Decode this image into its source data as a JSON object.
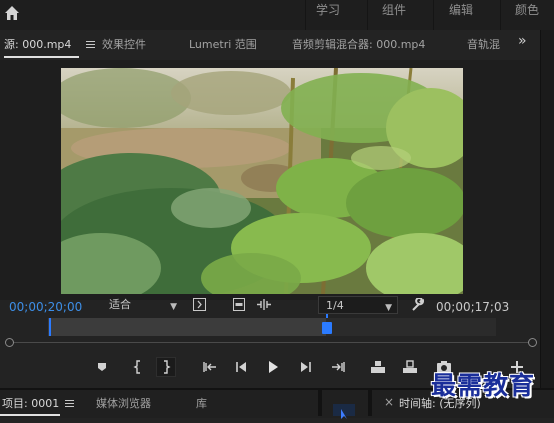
{
  "workspaces": [
    "学习",
    "组件",
    "编辑",
    "颜色"
  ],
  "tabs": [
    {
      "label": "源: 000.mp4",
      "active": true
    },
    {
      "label": "效果控件",
      "active": false
    },
    {
      "label": "Lumetri 范围",
      "active": false
    },
    {
      "label": "音频剪辑混合器: 000.mp4",
      "active": false
    },
    {
      "label": "音轨混",
      "active": false
    }
  ],
  "overflow_label": "»",
  "monitor": {
    "current_timecode": "00;00;20;00",
    "duration_timecode": "00;00;17;03",
    "fit_value": "适合",
    "resolution_value": "1/4",
    "playhead_progress": 0.62
  },
  "transport_icons": [
    "marker-icon",
    "mark-in-icon",
    "mark-out-icon",
    "go-to-in-icon",
    "step-back-icon",
    "play-icon",
    "step-forward-icon",
    "go-to-out-icon",
    "insert-icon",
    "overwrite-icon",
    "export-frame-icon",
    "add-button-icon"
  ],
  "bottom_tabs": [
    {
      "label": "项目: 0001",
      "active": true
    },
    {
      "label": "媒体浏览器",
      "active": false
    },
    {
      "label": "库",
      "active": false
    }
  ],
  "timeline_tab": {
    "close_label": "×",
    "label": "时间轴: (无序列)"
  },
  "watermark": "最需教育",
  "colors": {
    "accent_blue": "#2b7bff",
    "timecode_blue": "#3d8ee6",
    "panel_bg": "#232323"
  }
}
